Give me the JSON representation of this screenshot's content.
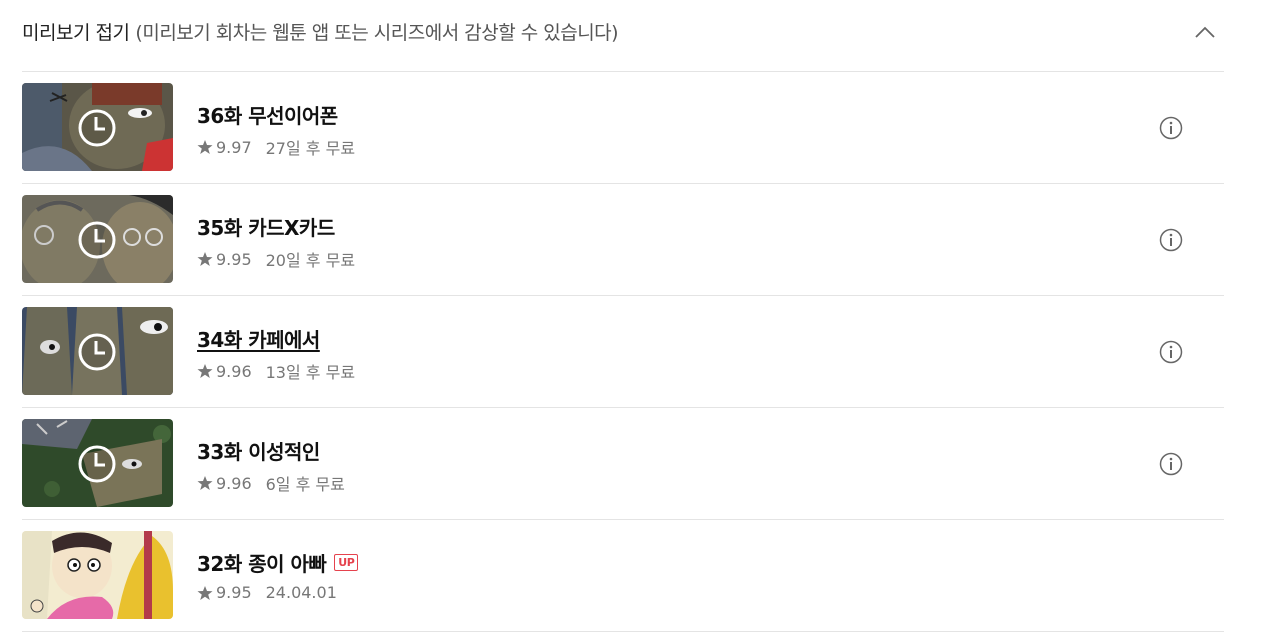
{
  "header": {
    "title": "미리보기 접기",
    "subtitle": "(미리보기 회차는 웹툰 앱 또는 시리즈에서 감상할 수 있습니다)",
    "toggle_icon": "chevron-up-icon"
  },
  "episodes": [
    {
      "title": "36화 무선이어폰",
      "rating": "9.97",
      "status": "27일 후 무료",
      "locked": true,
      "up_badge": ""
    },
    {
      "title": "35화 카드X카드",
      "rating": "9.95",
      "status": "20일 후 무료",
      "locked": true,
      "up_badge": ""
    },
    {
      "title": "34화 카페에서",
      "rating": "9.96",
      "status": "13일 후 무료",
      "locked": true,
      "up_badge": ""
    },
    {
      "title": "33화 이성적인",
      "rating": "9.96",
      "status": "6일 후 무료",
      "locked": true,
      "up_badge": ""
    },
    {
      "title": "32화 종이 아빠",
      "rating": "9.95",
      "status": "24.04.01",
      "locked": false,
      "up_badge": "UP"
    }
  ],
  "colors": {
    "badge": "#e5424d",
    "meta_text": "#777777",
    "divider": "#e4e4e4"
  },
  "icons": [
    "chevron-up-icon",
    "clock-icon",
    "star-icon",
    "info-icon"
  ]
}
